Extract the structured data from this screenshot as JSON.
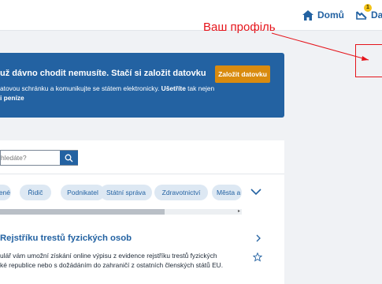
{
  "header": {
    "home_label": "Domů",
    "inbox_label": "Da",
    "badge_count": "1"
  },
  "annotation": {
    "text": "Ваш профіль",
    "color": "#e5141b"
  },
  "banner": {
    "title": "už dávno chodit nemusíte. Stačí si založit datovku",
    "line1_prefix": "atovou schránku a komunikujte se státem elektronicky. ",
    "line1_bold": "Ušetříte",
    "line1_suffix": " tak nejen",
    "line2": "i peníze",
    "button_label": "Založit datovku",
    "bg_color": "#2362a2",
    "button_color": "#d98b0f"
  },
  "search": {
    "placeholder": "hledáte?"
  },
  "chips": [
    "ené",
    "Řidič",
    "Podnikatel",
    "Státní správa",
    "Zdravotnictví",
    "Města a"
  ],
  "scrollbar": {
    "position": 0.68
  },
  "result": {
    "title": "Rejstříku trestů fyzických osob",
    "line1": "ulář vám umožní získání online výpisu z evidence rejstříku trestů fyzických",
    "line2": "ké republice nebo s dožádáním do zahraničí z ostatních členských států EU."
  }
}
